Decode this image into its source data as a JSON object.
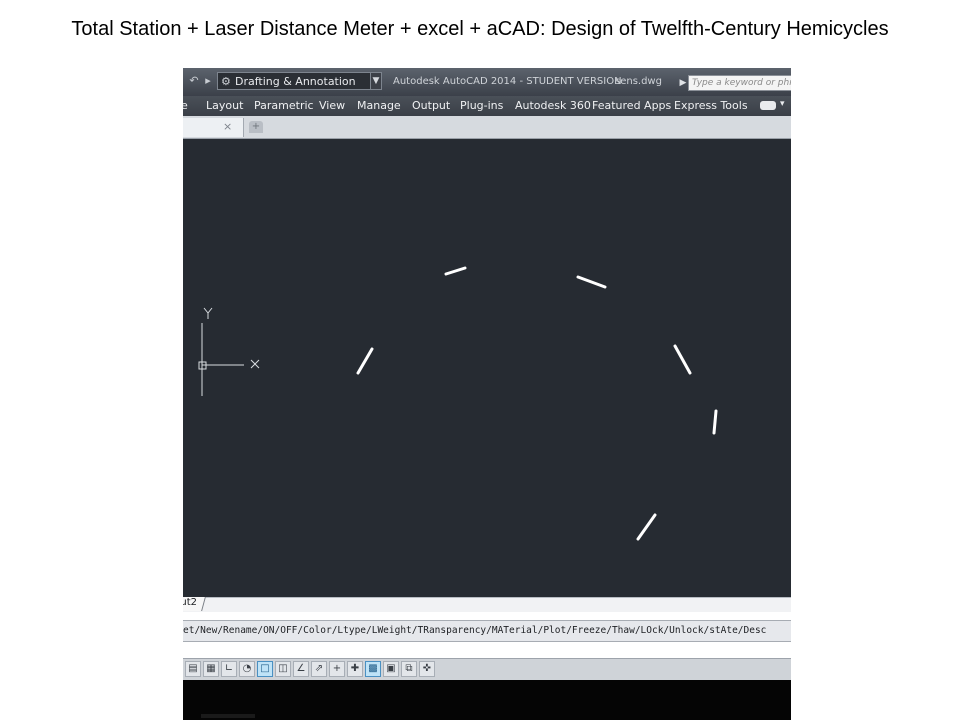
{
  "slide": {
    "title": "Total Station + Laser Distance Meter + excel + aCAD: Design of Twelfth-Century Hemicycles"
  },
  "titlebar": {
    "undo_icon": "undo-arrow-icon",
    "redo_icon": "redo-arrow-icon",
    "workspace": "Drafting & Annotation",
    "app_title": "Autodesk AutoCAD 2014 - STUDENT VERSION",
    "file_name": "sens.dwg",
    "search_placeholder": "Type a keyword or phrase"
  },
  "ribbon": {
    "tabs": [
      "e",
      "Layout",
      "Parametric",
      "View",
      "Manage",
      "Output",
      "Plug-ins",
      "Autodesk 360",
      "Featured Apps",
      "Express Tools"
    ]
  },
  "document": {
    "close_glyph": "×",
    "new_tab_glyph": "+"
  },
  "canvas": {
    "background": "#262b32",
    "line_color": "#ffffff",
    "ucs": {
      "y_label": "Y",
      "x_label": "X"
    }
  },
  "layout": {
    "tab_label": "ut2"
  },
  "command_line": {
    "text": "et/New/Rename/ON/OFF/Color/Ltype/LWeight/TRansparency/MATerial/Plot/Freeze/Thaw/LOck/Unlock/stAte/Desc"
  },
  "status_bar": {
    "buttons": [
      {
        "name": "model-space-icon",
        "glyph": "▤",
        "on": false
      },
      {
        "name": "grid-icon",
        "glyph": "▦",
        "on": false
      },
      {
        "name": "ortho-icon",
        "glyph": "∟",
        "on": false
      },
      {
        "name": "polar-icon",
        "glyph": "◔",
        "on": false
      },
      {
        "name": "osnap-icon",
        "glyph": "□",
        "on": true
      },
      {
        "name": "3d-osnap-icon",
        "glyph": "◫",
        "on": false
      },
      {
        "name": "object-tracking-icon",
        "glyph": "∠",
        "on": false
      },
      {
        "name": "dynamic-ucs-icon",
        "glyph": "⇗",
        "on": false
      },
      {
        "name": "dynamic-input-icon",
        "glyph": "+",
        "on": false
      },
      {
        "name": "lineweight-icon",
        "glyph": "✚",
        "on": false
      },
      {
        "name": "transparency-icon",
        "glyph": "▩",
        "on": true
      },
      {
        "name": "quick-properties-icon",
        "glyph": "▣",
        "on": false
      },
      {
        "name": "selection-cycling-icon",
        "glyph": "⧉",
        "on": false
      },
      {
        "name": "annotation-monitor-icon",
        "glyph": "✜",
        "on": false
      }
    ]
  }
}
